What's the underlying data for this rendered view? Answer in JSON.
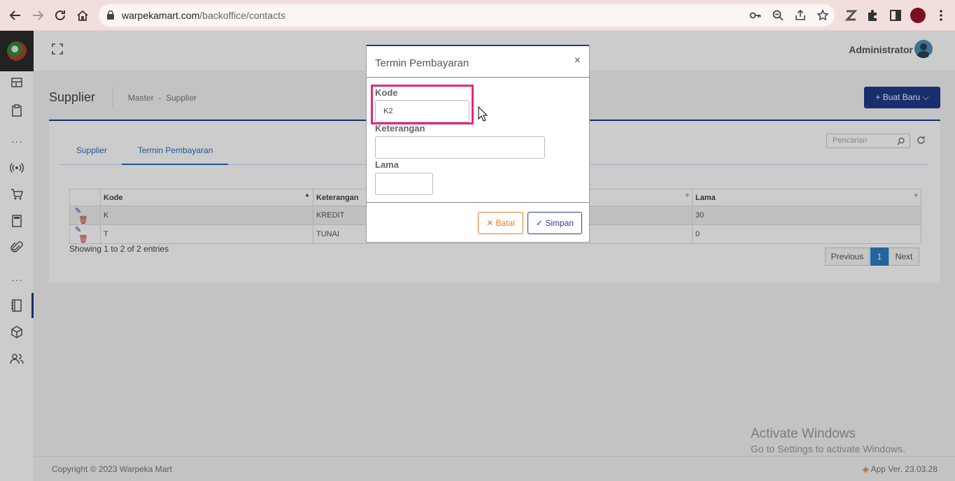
{
  "browser": {
    "url_domain": "warpekamart.com",
    "url_path": "/backoffice/contacts"
  },
  "topbar": {
    "user_name": "Administrator"
  },
  "page": {
    "title": "Supplier",
    "breadcrumb": "Master  -  Supplier",
    "new_button": "+ Buat Baru ⌵"
  },
  "tabs": [
    {
      "label": "Supplier"
    },
    {
      "label": "Termin Pembayaran"
    }
  ],
  "search": {
    "placeholder": "Pencarian"
  },
  "table": {
    "columns": [
      "Kode",
      "Keterangan",
      "Lama"
    ],
    "rows": [
      {
        "kode": "K",
        "keterangan": "KREDIT",
        "lama": "30"
      },
      {
        "kode": "T",
        "keterangan": "TUNAI",
        "lama": "0"
      }
    ],
    "info": "Showing 1 to 2 of 2 entries"
  },
  "pagination": {
    "previous": "Previous",
    "current": "1",
    "next": "Next"
  },
  "modal": {
    "title": "Termin Pembayaran",
    "close": "×",
    "fields": {
      "kode_label": "Kode",
      "kode_value": "K2",
      "keterangan_label": "Keterangan",
      "keterangan_value": "",
      "lama_label": "Lama",
      "lama_value": ""
    },
    "cancel_label": "✕ Batal",
    "save_label": "✓ Simpan"
  },
  "footer": {
    "copyright": "Copyright © 2023 Warpeka Mart",
    "version": "App Ver. 23.03.28"
  },
  "watermark": {
    "line1": "Activate Windows",
    "line2": "Go to Settings to activate Windows."
  },
  "colors": {
    "primary": "#1e3a8a",
    "link": "#2a6ebf",
    "highlight": "#e6267f",
    "warning": "#e67e22"
  }
}
